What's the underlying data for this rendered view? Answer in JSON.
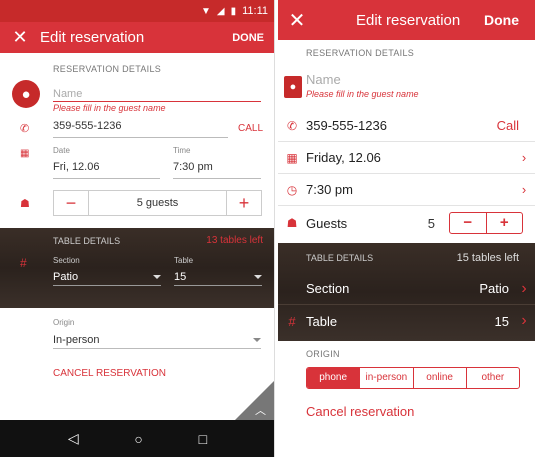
{
  "left": {
    "status_time": "11:11",
    "title": "Edit reservation",
    "done": "DONE",
    "reservation_details": "RESERVATION DETAILS",
    "name_placeholder": "Name",
    "name_error": "Please fill in the guest name",
    "phone": "359-555-1236",
    "call": "CALL",
    "date_label": "Date",
    "date_value": "Fri, 12.06",
    "time_label": "Time",
    "time_value": "7:30 pm",
    "guests": "5 guests",
    "minus": "−",
    "plus": "+",
    "table_details": "TABLE DETAILS",
    "tables_left": "13 tables left",
    "section_label": "Section",
    "section_value": "Patio",
    "table_label": "Table",
    "table_value": "15",
    "origin_label": "Origin",
    "origin_value": "In-person",
    "cancel": "CANCEL RESERVATION"
  },
  "right": {
    "title": "Edit reservation",
    "done": "Done",
    "reservation_details": "RESERVATION DETAILS",
    "name_placeholder": "Name",
    "name_error": "Please fill in the guest name",
    "phone": "359-555-1236",
    "call": "Call",
    "date_value": "Friday, 12.06",
    "time_value": "7:30 pm",
    "guests_label": "Guests",
    "guests_count": "5",
    "minus": "−",
    "plus": "+",
    "table_details": "TABLE DETAILS",
    "tables_left": "15 tables left",
    "section_label": "Section",
    "section_value": "Patio",
    "table_label": "Table",
    "table_value": "15",
    "origin_label": "ORIGIN",
    "origin_options": [
      "phone",
      "in-person",
      "online",
      "other"
    ],
    "origin_selected": "phone",
    "cancel": "Cancel reservation"
  },
  "colors": {
    "accent": "#d8333a",
    "wood": "#2f2620"
  },
  "icons": [
    "close-icon",
    "person-icon",
    "phone-icon",
    "calendar-icon",
    "clock-icon",
    "guests-icon",
    "hash-icon",
    "chevron-right-icon",
    "back-icon",
    "home-icon",
    "recents-icon"
  ]
}
